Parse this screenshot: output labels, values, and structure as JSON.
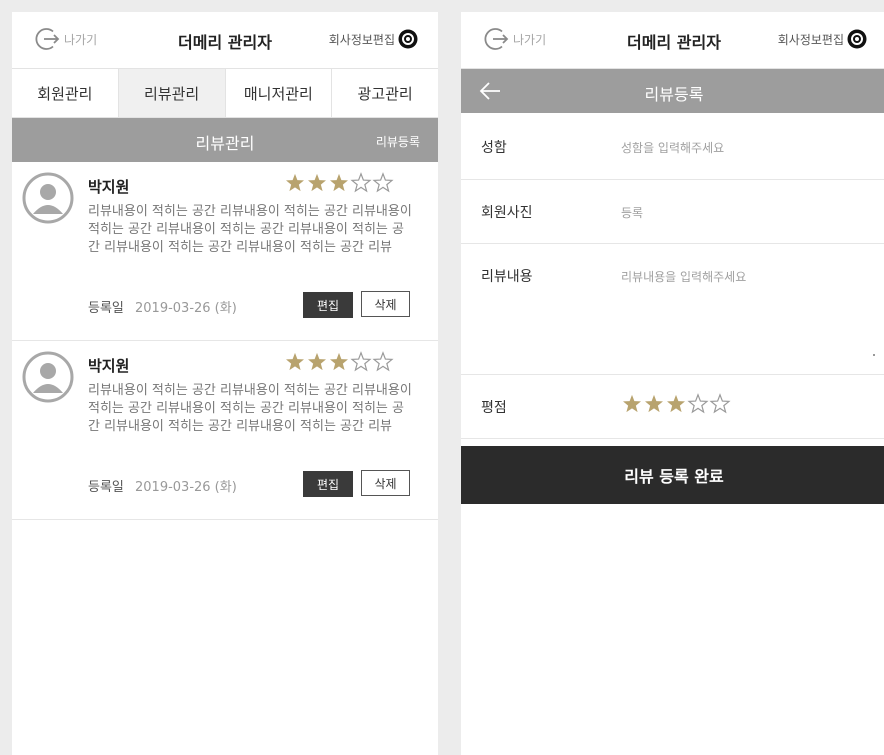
{
  "header": {
    "exit_label": "나가기",
    "title": "더메리 관리자",
    "company_label": "회사정보편집"
  },
  "tabs": [
    {
      "label": "회원관리",
      "active": false
    },
    {
      "label": "리뷰관리",
      "active": true
    },
    {
      "label": "매니저관리",
      "active": false
    },
    {
      "label": "광고관리",
      "active": false
    }
  ],
  "review_list": {
    "section_title": "리뷰관리",
    "register_link": "리뷰등록",
    "date_label": "등록일",
    "edit_label": "편집",
    "delete_label": "삭제",
    "items": [
      {
        "name": "박지원",
        "rating": 3,
        "max_rating": 5,
        "text": "리뷰내용이 적히는 공간 리뷰내용이 적히는 공간 리뷰내용이 적히는 공간 리뷰내용이 적히는 공간 리뷰내용이 적히는 공간 리뷰내용이 적히는 공간 리뷰내용이 적히는 공간 리뷰",
        "date": "2019-03-26 (화)"
      },
      {
        "name": "박지원",
        "rating": 3,
        "max_rating": 5,
        "text": "리뷰내용이 적히는 공간 리뷰내용이 적히는 공간 리뷰내용이 적히는 공간 리뷰내용이 적히는 공간 리뷰내용이 적히는 공간 리뷰내용이 적히는 공간 리뷰내용이 적히는 공간 리뷰",
        "date": "2019-03-26 (화)"
      }
    ]
  },
  "review_form": {
    "title": "리뷰등록",
    "name_label": "성함",
    "name_placeholder": "성함을 입력해주세요",
    "photo_label": "회원사진",
    "photo_value": "등록",
    "content_label": "리뷰내용",
    "content_placeholder": "리뷰내용을 입력해주세요",
    "rating_label": "평점",
    "rating": 3,
    "max_rating": 5,
    "submit_label": "리뷰 등록 완료"
  },
  "colors": {
    "star_filled": "#b8a36e",
    "star_empty": "#999999",
    "section_header": "#9d9d9d",
    "dark_button": "#2b2b2b"
  },
  "icons": [
    "exit-icon",
    "gear-icon",
    "back-arrow-icon",
    "avatar-icon",
    "star-filled-icon",
    "star-empty-icon"
  ]
}
